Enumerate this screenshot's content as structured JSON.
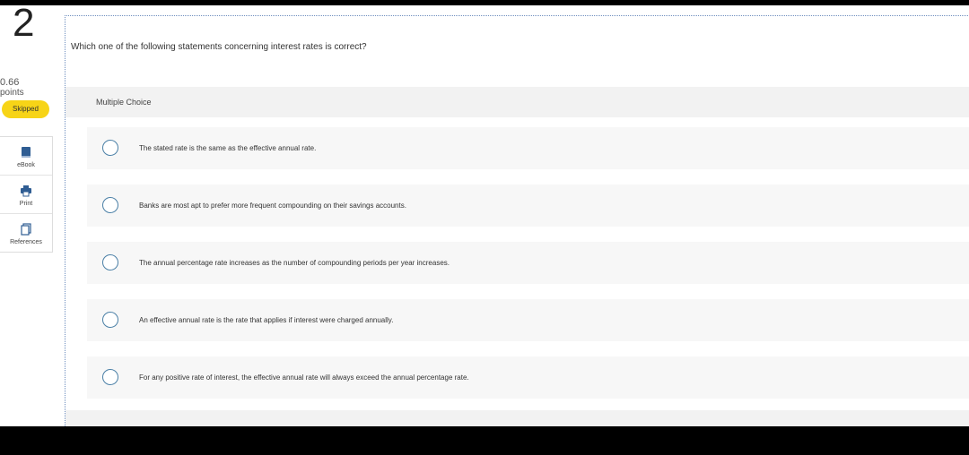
{
  "question": {
    "number": "2",
    "points_value": "0.66",
    "points_label": "points",
    "status_badge": "Skipped",
    "prompt": "Which one of the following statements concerning interest rates is correct?",
    "type_label": "Multiple Choice",
    "options": [
      {
        "text": "The stated rate is the same as the effective annual rate.",
        "selected": false
      },
      {
        "text": "Banks are most apt to prefer more frequent compounding on their savings accounts.",
        "selected": false
      },
      {
        "text": "The annual percentage rate increases as the number of compounding periods per year increases.",
        "selected": false
      },
      {
        "text": "An effective annual rate is the rate that applies if interest were charged annually.",
        "selected": false
      },
      {
        "text": "For any positive rate of interest, the effective annual rate will always exceed the annual percentage rate.",
        "selected": false
      }
    ]
  },
  "tools": [
    {
      "label": "eBook",
      "icon": "book-icon"
    },
    {
      "label": "Print",
      "icon": "printer-icon"
    },
    {
      "label": "References",
      "icon": "document-icon"
    }
  ],
  "colors": {
    "badge": "#f7d417",
    "radio": "#4a7fa6",
    "band": "#f2f2f2",
    "option_bg": "#f7f7f7",
    "icon": "#2f5d93"
  }
}
